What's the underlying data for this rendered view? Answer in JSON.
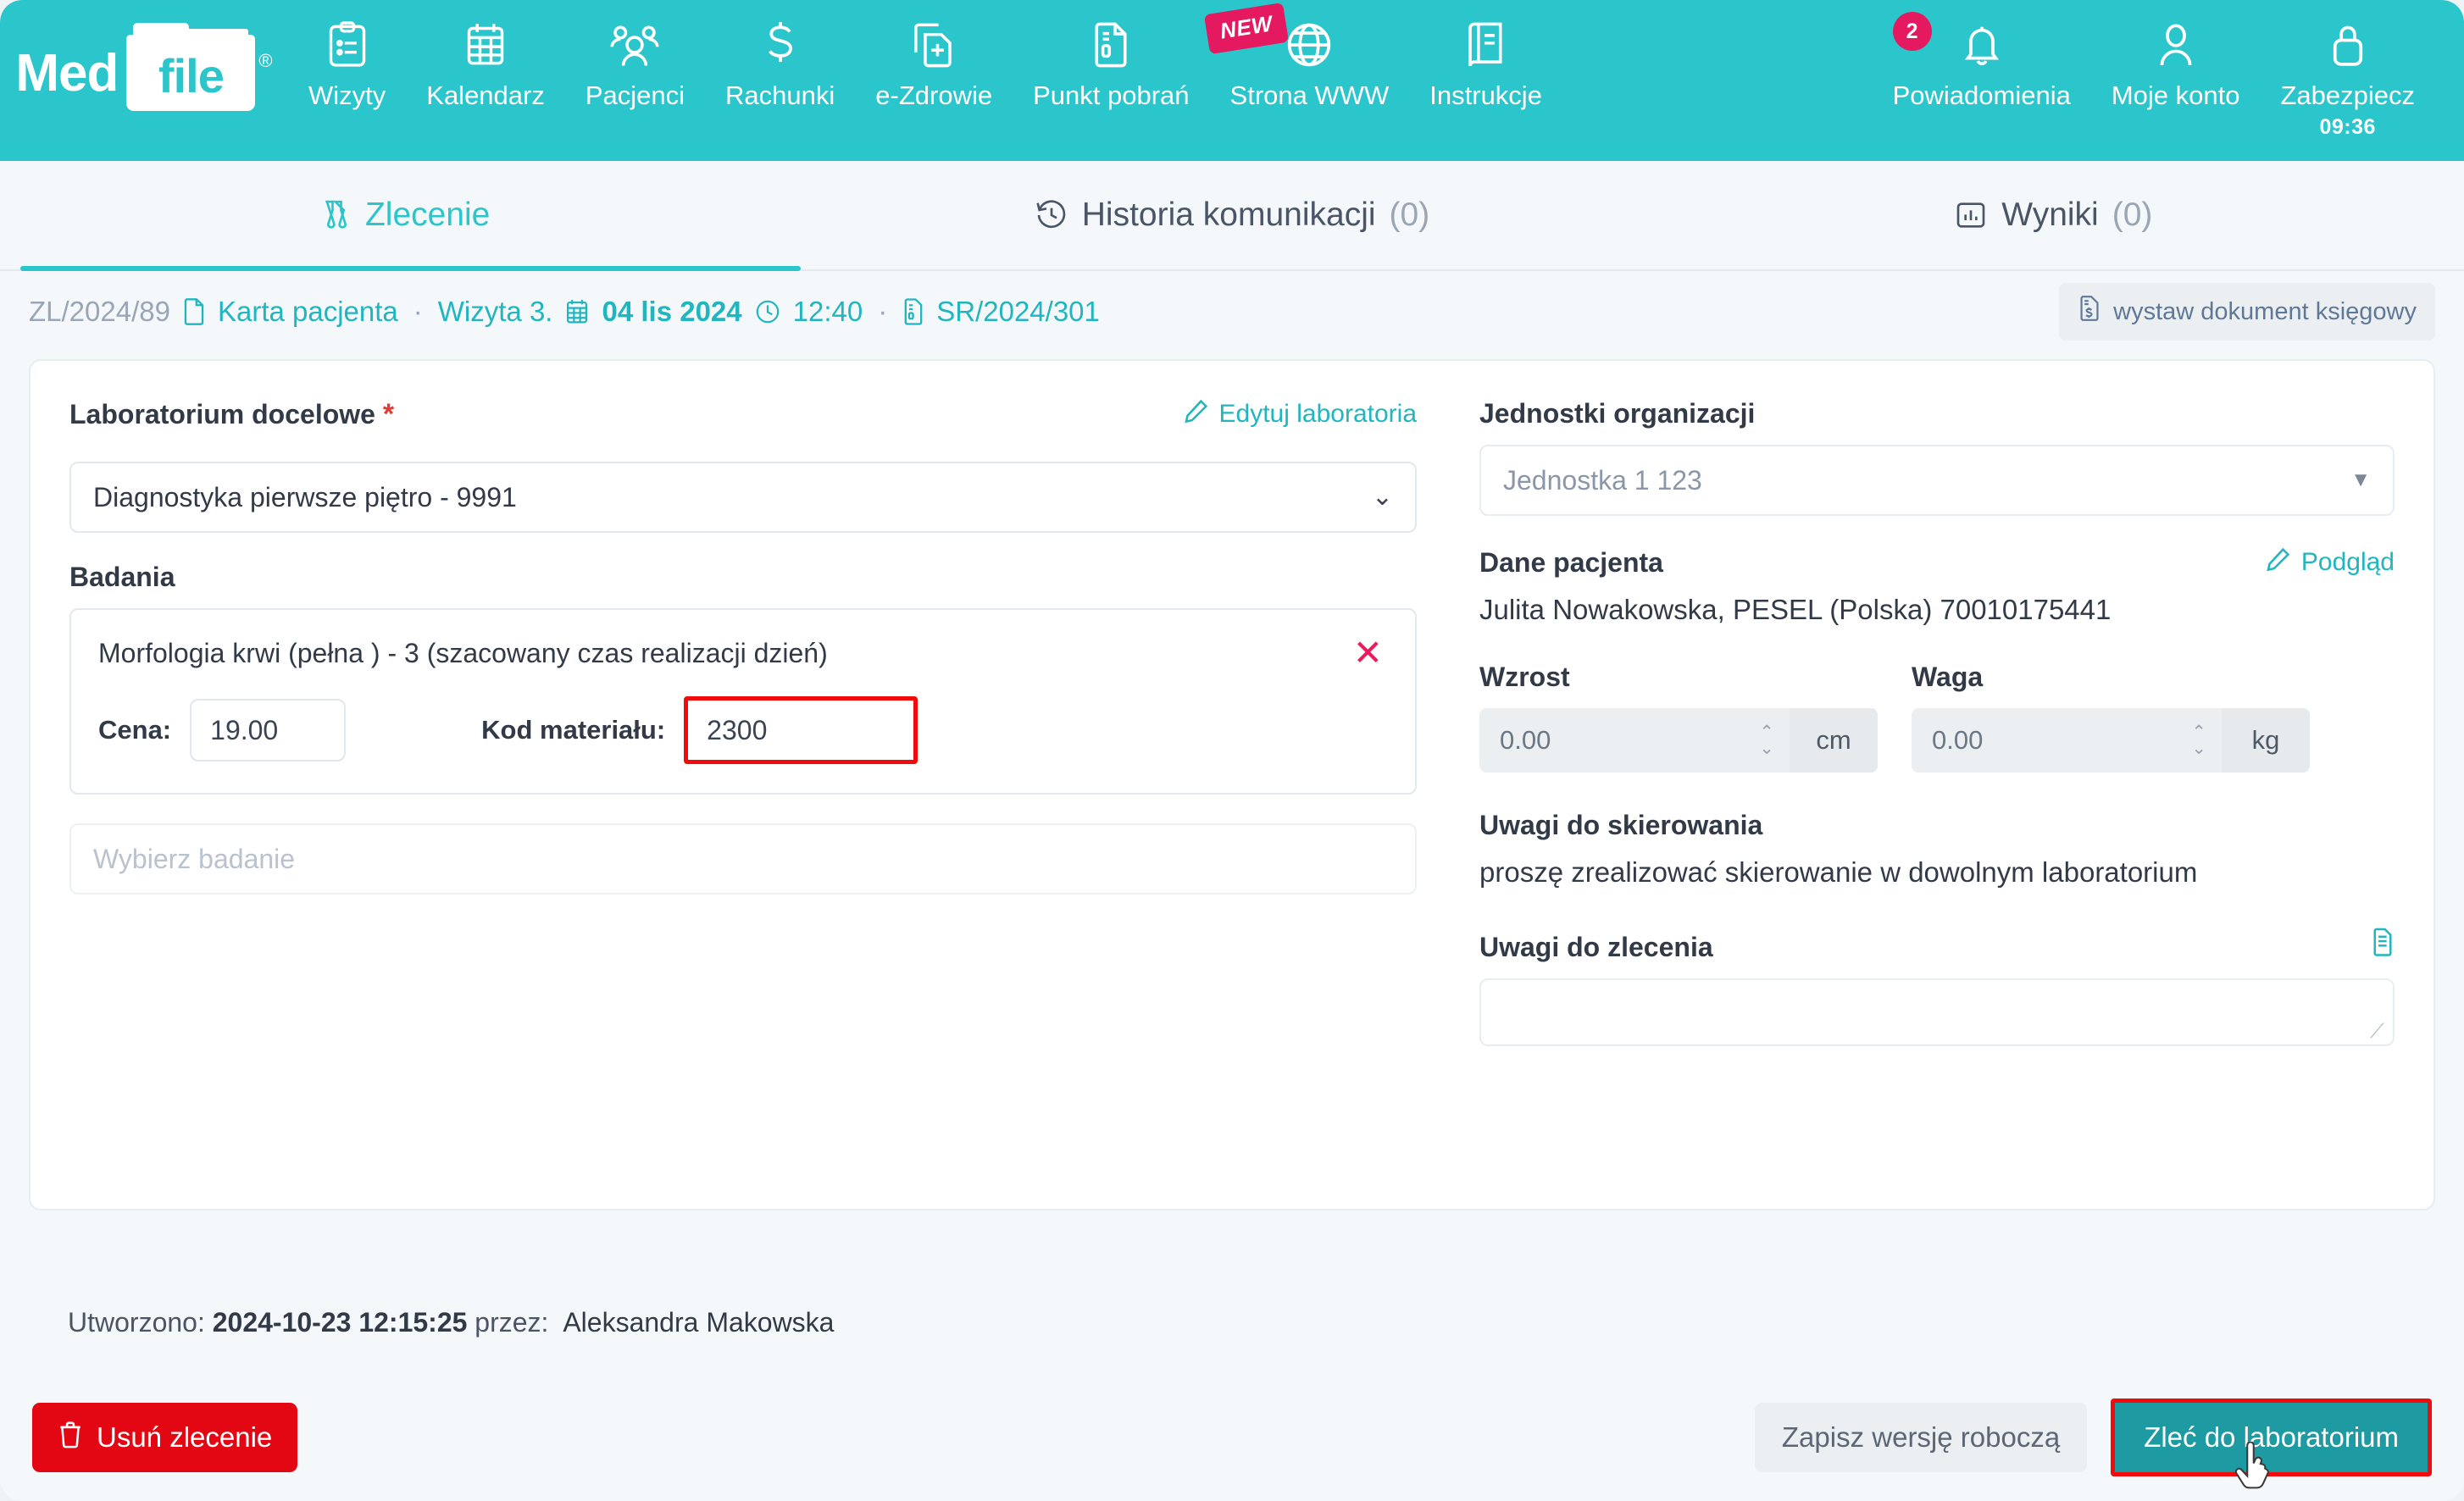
{
  "brand": {
    "name_part1": "Med",
    "name_part2": "file",
    "registered_mark": "®",
    "header_color": "#2bc5cc",
    "accent_color": "#21b5bf",
    "danger_color": "#e30613",
    "badge_color": "#e5195f"
  },
  "nav": {
    "items": [
      {
        "label": "Wizyty",
        "icon": "clipboard-icon"
      },
      {
        "label": "Kalendarz",
        "icon": "calendar-icon"
      },
      {
        "label": "Pacjenci",
        "icon": "people-icon"
      },
      {
        "label": "Rachunki",
        "icon": "dollar-icon"
      },
      {
        "label": "e-Zdrowie",
        "icon": "document-plus-icon"
      },
      {
        "label": "Punkt pobrań",
        "icon": "document-lines-icon"
      },
      {
        "label": "Strona WWW",
        "icon": "globe-icon",
        "badge": "NEW"
      },
      {
        "label": "Instrukcje",
        "icon": "book-icon"
      }
    ],
    "right_items": [
      {
        "label": "Powiadomienia",
        "icon": "bell-icon",
        "badge": "2"
      },
      {
        "label": "Moje konto",
        "icon": "user-icon"
      },
      {
        "label": "Zabezpiecz",
        "icon": "lock-icon",
        "sub": "09:36"
      }
    ]
  },
  "tabs": [
    {
      "label": "Zlecenie",
      "count": "",
      "icon": "flask-icon",
      "active": true
    },
    {
      "label": "Historia komunikacji",
      "count": "(0)",
      "icon": "history-icon",
      "active": false
    },
    {
      "label": "Wyniki",
      "count": "(0)",
      "icon": "chart-icon",
      "active": false
    }
  ],
  "breadcrumb": {
    "order_id": "ZL/2024/89",
    "patient_card": "Karta pacjenta",
    "visit": "Wizyta 3.",
    "date": "04 lis 2024",
    "time": "12:40",
    "referral_id": "SR/2024/301",
    "separator": "·",
    "ledger_button": "wystaw dokument księgowy"
  },
  "form": {
    "lab_label": "Laboratorium docelowe",
    "lab_required_mark": "*",
    "lab_edit_link": "Edytuj laboratoria",
    "lab_value": "Diagnostyka pierwsze piętro - 9991",
    "exams_label": "Badania",
    "exam": {
      "name": "Morfologia krwi (pełna ) - 3 (szacowany czas realizacji dzień)",
      "price_label": "Cena:",
      "price_value": "19.00",
      "material_label": "Kod materiału:",
      "material_value": "2300",
      "remove_glyph": "✕"
    },
    "add_exam_placeholder": "Wybierz badanie"
  },
  "right": {
    "units_label": "Jednostki organizacji",
    "units_value": "Jednostka 1 123",
    "patient_label": "Dane pacjenta",
    "patient_preview_link": "Podgląd",
    "patient_value": "Julita Nowakowska, PESEL (Polska) 70010175441",
    "height_label": "Wzrost",
    "height_value": "0.00",
    "height_unit": "cm",
    "weight_label": "Waga",
    "weight_value": "0.00",
    "weight_unit": "kg",
    "referral_notes_label": "Uwagi do skierowania",
    "referral_notes_value": "proszę zrealizować skierowanie w dowolnym laboratorium",
    "order_notes_label": "Uwagi do zlecenia",
    "order_notes_value": ""
  },
  "created": {
    "prefix": "Utworzono:",
    "timestamp": "2024-10-23 12:15:25",
    "by_label": "przez:",
    "author": "Aleksandra Makowska"
  },
  "footer": {
    "delete_label": "Usuń zlecenie",
    "draft_label": "Zapisz wersję roboczą",
    "order_label": "Zleć do laboratorium"
  }
}
